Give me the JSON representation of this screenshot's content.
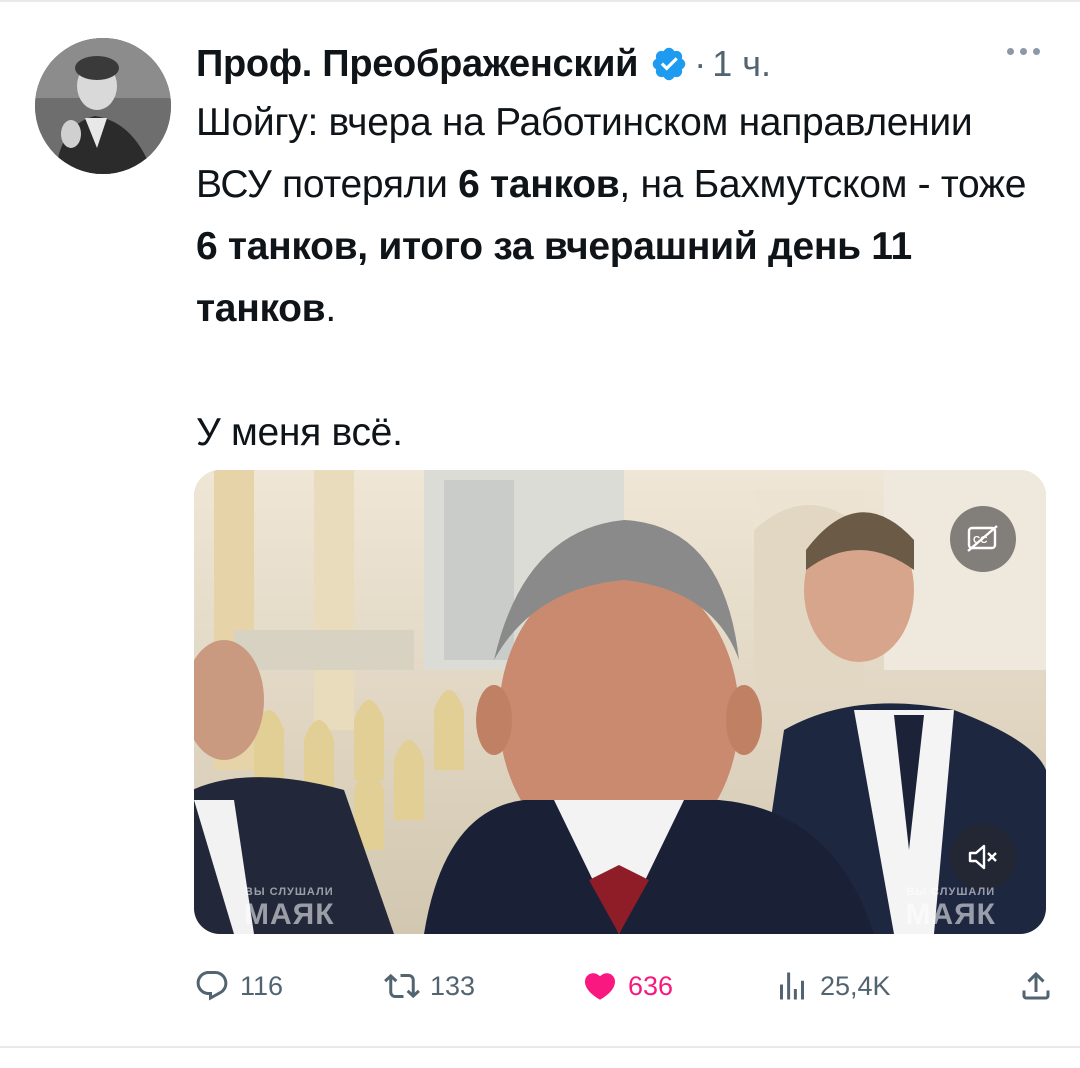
{
  "tweet": {
    "author": "Проф. Преображенский",
    "time_sep": "·",
    "time": "1 ч.",
    "text": {
      "t1": "Шойгу: вчера на Работинском направлении ВСУ потеряли ",
      "b1": "6 танков",
      "t2": ", на Бахмутском - тоже ",
      "b2": "6 танков, итого за вчерашний день 11 танков",
      "t3": ".",
      "p2": "У меня всё."
    },
    "media": {
      "watermark_small": "ВЫ СЛУШАЛИ",
      "watermark_big": "МАЯК"
    },
    "stats": {
      "replies": "116",
      "retweets": "133",
      "likes": "636",
      "views": "25,4K"
    }
  },
  "icons": {
    "verified": "verified-badge-icon",
    "more": "more-dots-icon",
    "reply": "reply-bubble-icon",
    "retweet": "retweet-icon",
    "like": "heart-icon",
    "views": "views-chart-icon",
    "share": "share-icon",
    "captions": "captions-off-icon",
    "mute": "muted-speaker-icon"
  },
  "colors": {
    "like": "#f91880",
    "verified": "#1d9bf0",
    "muted_text": "#536471"
  }
}
